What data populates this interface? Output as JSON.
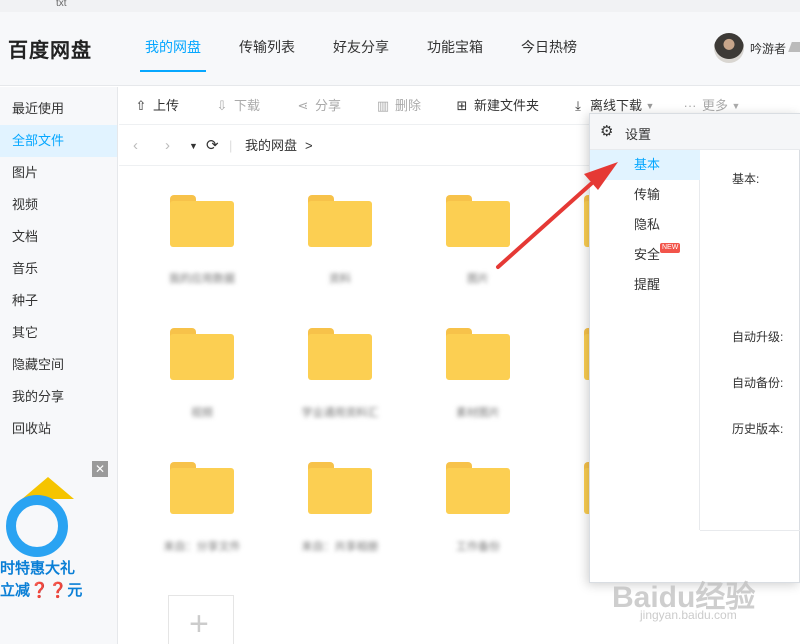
{
  "window": {
    "tab_hint": "txt"
  },
  "header": {
    "logo": "百度网盘",
    "nav": [
      "我的网盘",
      "传输列表",
      "好友分享",
      "功能宝箱",
      "今日热榜"
    ],
    "active_nav": 0,
    "username": "吟游者"
  },
  "sidebar": {
    "items": [
      "最近使用",
      "全部文件",
      "图片",
      "视频",
      "文档",
      "音乐",
      "种子",
      "其它",
      "隐藏空间",
      "我的分享",
      "回收站"
    ],
    "active_index": 1,
    "ad": {
      "close": "✕",
      "line1": "时特惠大礼",
      "line2": "立减❓❓元"
    }
  },
  "toolbar": {
    "upload": "上传",
    "download": "下载",
    "share": "分享",
    "delete": "删除",
    "new_folder": "新建文件夹",
    "offline_download": "离线下载",
    "more": "更多"
  },
  "breadcrumb": {
    "root": "我的网盘",
    "sep": ">"
  },
  "files": [
    {
      "name": "我的应用数据"
    },
    {
      "name": "资料"
    },
    {
      "name": "图片"
    },
    {
      "name": "视频"
    },
    {
      "name": "学业通用资料汇"
    },
    {
      "name": "素材图片"
    },
    {
      "name": "来自：分享文件"
    },
    {
      "name": "来自：共享相册"
    },
    {
      "name": "工作备份"
    }
  ],
  "settings_dialog": {
    "title": "设置",
    "nav": [
      "基本",
      "传输",
      "隐私",
      "安全",
      "提醒"
    ],
    "active_index": 0,
    "new_badge": "NEW",
    "labels": {
      "basic": "基本:",
      "auto_upgrade": "自动升级:",
      "auto_backup": "自动备份:",
      "history": "历史版本:"
    }
  },
  "watermark": {
    "main": "Baidu经验",
    "sub": "jingyan.baidu.com"
  },
  "colors": {
    "accent": "#06a7ff",
    "folder": "#fccf52",
    "arrow": "#e53935"
  }
}
